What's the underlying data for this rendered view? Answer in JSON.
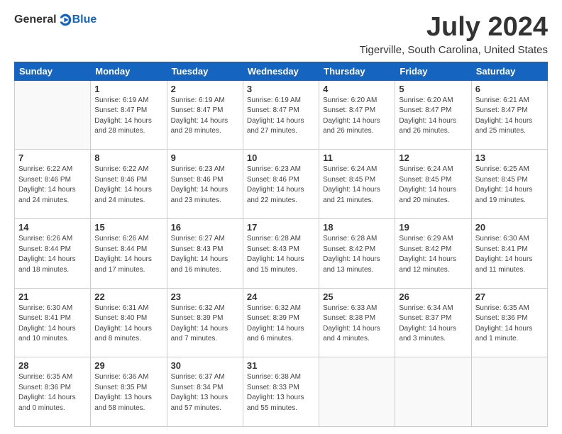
{
  "header": {
    "logo": {
      "general": "General",
      "blue": "Blue"
    },
    "title": "July 2024",
    "location": "Tigerville, South Carolina, United States"
  },
  "weekdays": [
    "Sunday",
    "Monday",
    "Tuesday",
    "Wednesday",
    "Thursday",
    "Friday",
    "Saturday"
  ],
  "weeks": [
    [
      null,
      {
        "day": "1",
        "sunrise": "6:19 AM",
        "sunset": "8:47 PM",
        "daylight": "14 hours and 28 minutes."
      },
      {
        "day": "2",
        "sunrise": "6:19 AM",
        "sunset": "8:47 PM",
        "daylight": "14 hours and 28 minutes."
      },
      {
        "day": "3",
        "sunrise": "6:19 AM",
        "sunset": "8:47 PM",
        "daylight": "14 hours and 27 minutes."
      },
      {
        "day": "4",
        "sunrise": "6:20 AM",
        "sunset": "8:47 PM",
        "daylight": "14 hours and 26 minutes."
      },
      {
        "day": "5",
        "sunrise": "6:20 AM",
        "sunset": "8:47 PM",
        "daylight": "14 hours and 26 minutes."
      },
      {
        "day": "6",
        "sunrise": "6:21 AM",
        "sunset": "8:47 PM",
        "daylight": "14 hours and 25 minutes."
      }
    ],
    [
      {
        "day": "7",
        "sunrise": "6:22 AM",
        "sunset": "8:46 PM",
        "daylight": "14 hours and 24 minutes."
      },
      {
        "day": "8",
        "sunrise": "6:22 AM",
        "sunset": "8:46 PM",
        "daylight": "14 hours and 24 minutes."
      },
      {
        "day": "9",
        "sunrise": "6:23 AM",
        "sunset": "8:46 PM",
        "daylight": "14 hours and 23 minutes."
      },
      {
        "day": "10",
        "sunrise": "6:23 AM",
        "sunset": "8:46 PM",
        "daylight": "14 hours and 22 minutes."
      },
      {
        "day": "11",
        "sunrise": "6:24 AM",
        "sunset": "8:45 PM",
        "daylight": "14 hours and 21 minutes."
      },
      {
        "day": "12",
        "sunrise": "6:24 AM",
        "sunset": "8:45 PM",
        "daylight": "14 hours and 20 minutes."
      },
      {
        "day": "13",
        "sunrise": "6:25 AM",
        "sunset": "8:45 PM",
        "daylight": "14 hours and 19 minutes."
      }
    ],
    [
      {
        "day": "14",
        "sunrise": "6:26 AM",
        "sunset": "8:44 PM",
        "daylight": "14 hours and 18 minutes."
      },
      {
        "day": "15",
        "sunrise": "6:26 AM",
        "sunset": "8:44 PM",
        "daylight": "14 hours and 17 minutes."
      },
      {
        "day": "16",
        "sunrise": "6:27 AM",
        "sunset": "8:43 PM",
        "daylight": "14 hours and 16 minutes."
      },
      {
        "day": "17",
        "sunrise": "6:28 AM",
        "sunset": "8:43 PM",
        "daylight": "14 hours and 15 minutes."
      },
      {
        "day": "18",
        "sunrise": "6:28 AM",
        "sunset": "8:42 PM",
        "daylight": "14 hours and 13 minutes."
      },
      {
        "day": "19",
        "sunrise": "6:29 AM",
        "sunset": "8:42 PM",
        "daylight": "14 hours and 12 minutes."
      },
      {
        "day": "20",
        "sunrise": "6:30 AM",
        "sunset": "8:41 PM",
        "daylight": "14 hours and 11 minutes."
      }
    ],
    [
      {
        "day": "21",
        "sunrise": "6:30 AM",
        "sunset": "8:41 PM",
        "daylight": "14 hours and 10 minutes."
      },
      {
        "day": "22",
        "sunrise": "6:31 AM",
        "sunset": "8:40 PM",
        "daylight": "14 hours and 8 minutes."
      },
      {
        "day": "23",
        "sunrise": "6:32 AM",
        "sunset": "8:39 PM",
        "daylight": "14 hours and 7 minutes."
      },
      {
        "day": "24",
        "sunrise": "6:32 AM",
        "sunset": "8:39 PM",
        "daylight": "14 hours and 6 minutes."
      },
      {
        "day": "25",
        "sunrise": "6:33 AM",
        "sunset": "8:38 PM",
        "daylight": "14 hours and 4 minutes."
      },
      {
        "day": "26",
        "sunrise": "6:34 AM",
        "sunset": "8:37 PM",
        "daylight": "14 hours and 3 minutes."
      },
      {
        "day": "27",
        "sunrise": "6:35 AM",
        "sunset": "8:36 PM",
        "daylight": "14 hours and 1 minute."
      }
    ],
    [
      {
        "day": "28",
        "sunrise": "6:35 AM",
        "sunset": "8:36 PM",
        "daylight": "14 hours and 0 minutes."
      },
      {
        "day": "29",
        "sunrise": "6:36 AM",
        "sunset": "8:35 PM",
        "daylight": "13 hours and 58 minutes."
      },
      {
        "day": "30",
        "sunrise": "6:37 AM",
        "sunset": "8:34 PM",
        "daylight": "13 hours and 57 minutes."
      },
      {
        "day": "31",
        "sunrise": "6:38 AM",
        "sunset": "8:33 PM",
        "daylight": "13 hours and 55 minutes."
      },
      null,
      null,
      null
    ]
  ]
}
